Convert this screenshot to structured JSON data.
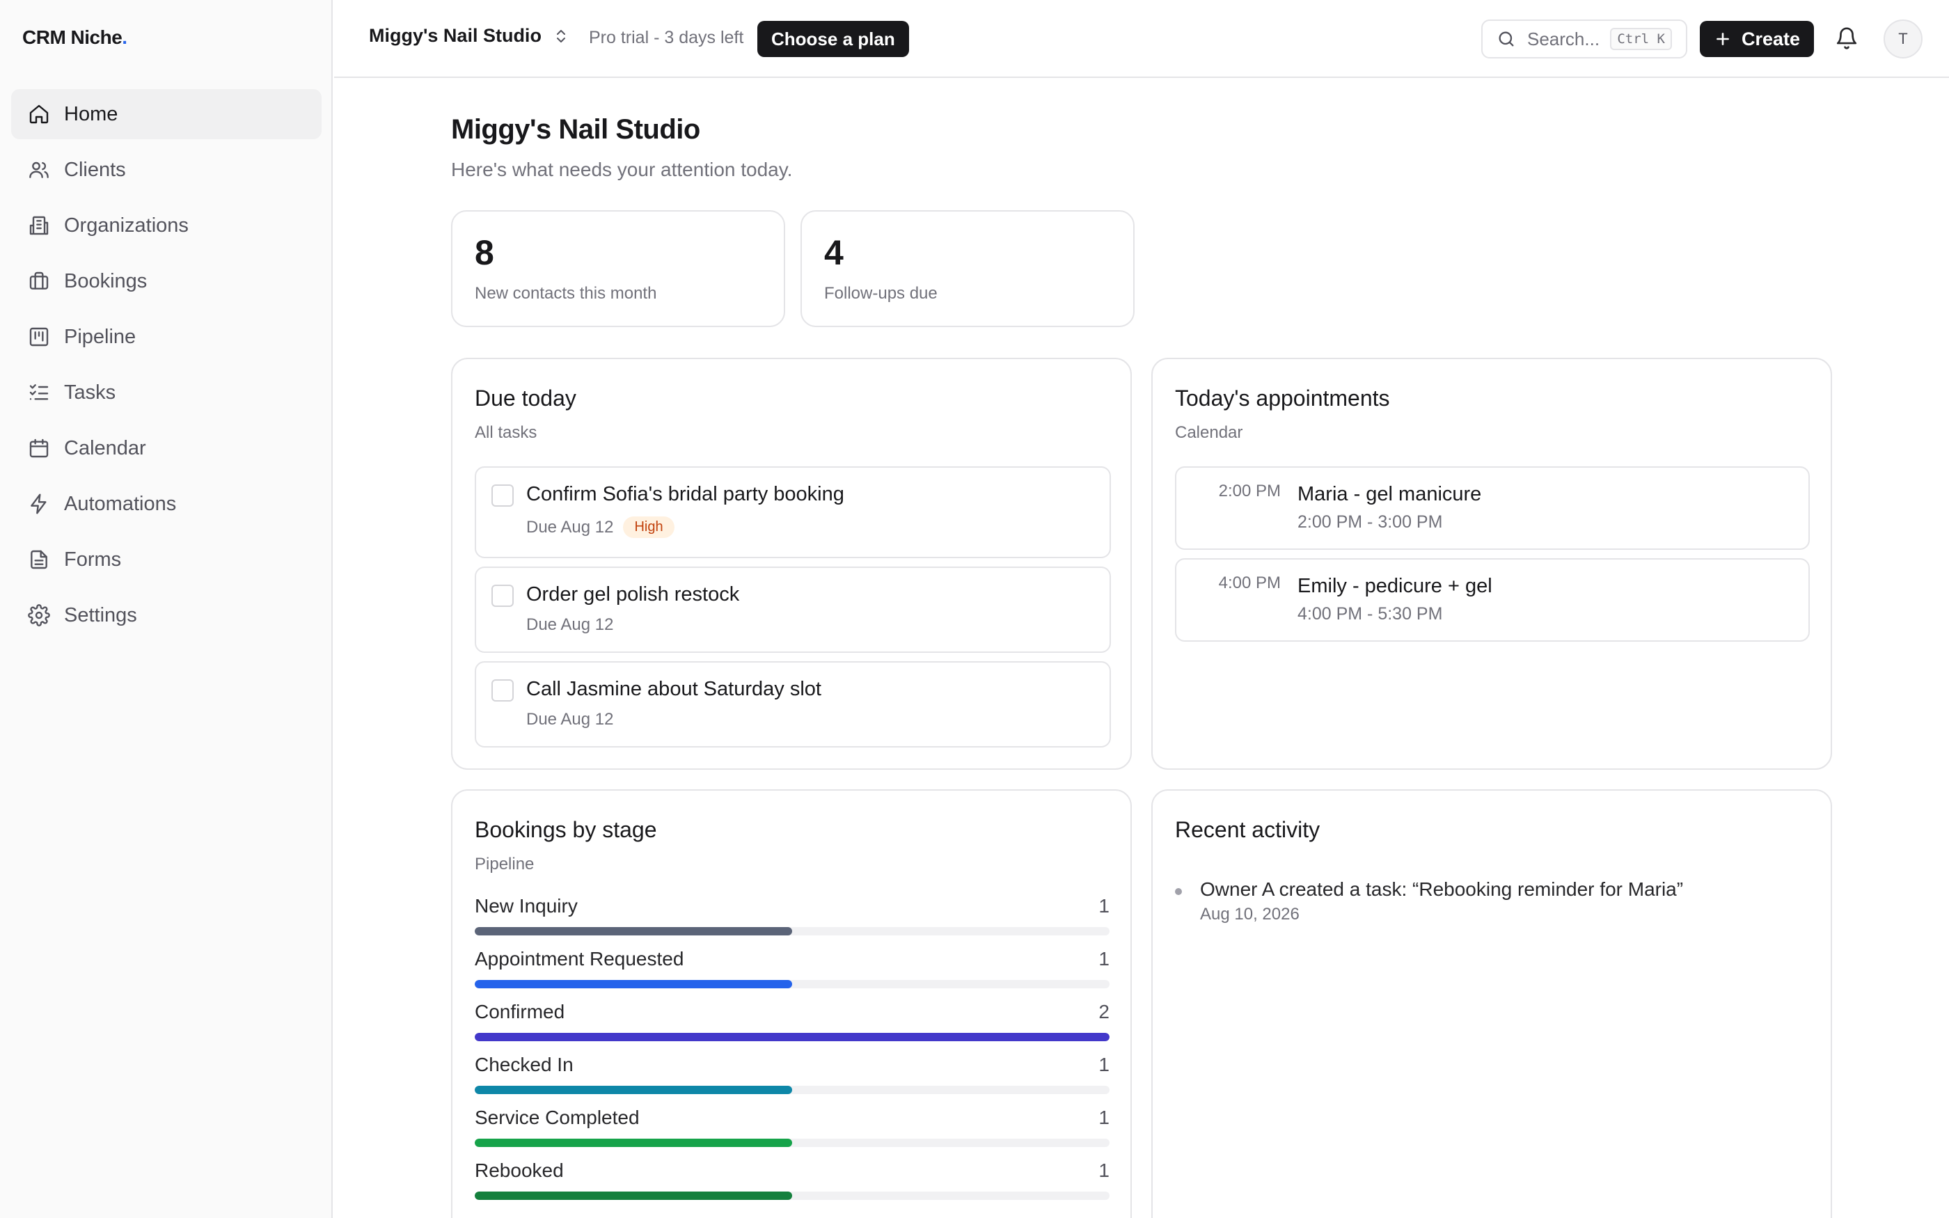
{
  "app": {
    "logo_text": "CRM Niche",
    "logo_dot": "."
  },
  "sidebar": {
    "items": [
      {
        "label": "Home",
        "icon": "home-icon",
        "active": true
      },
      {
        "label": "Clients",
        "icon": "users-icon"
      },
      {
        "label": "Organizations",
        "icon": "building-icon"
      },
      {
        "label": "Bookings",
        "icon": "briefcase-icon"
      },
      {
        "label": "Pipeline",
        "icon": "kanban-icon"
      },
      {
        "label": "Tasks",
        "icon": "list-checks-icon"
      },
      {
        "label": "Calendar",
        "icon": "calendar-icon"
      },
      {
        "label": "Automations",
        "icon": "zap-icon"
      },
      {
        "label": "Forms",
        "icon": "file-text-icon"
      },
      {
        "label": "Settings",
        "icon": "gear-icon"
      }
    ]
  },
  "topbar": {
    "workspace": "Miggy's Nail Studio",
    "trial_text": "Pro trial - 3 days left",
    "plan_button": "Choose a plan",
    "search_placeholder": "Search...",
    "search_shortcut": "Ctrl K",
    "create_button": "Create",
    "avatar_initial": "T"
  },
  "main": {
    "title": "Miggy's Nail Studio",
    "subtitle": "Here's what needs your attention today.",
    "stats": [
      {
        "value": "8",
        "label": "New contacts this month"
      },
      {
        "value": "4",
        "label": "Follow-ups due"
      }
    ],
    "due_today": {
      "title": "Due today",
      "subtitle": "All tasks",
      "tasks": [
        {
          "title": "Confirm Sofia's bridal party booking",
          "due": "Due Aug 12",
          "badge": "High"
        },
        {
          "title": "Order gel polish restock",
          "due": "Due Aug 12"
        },
        {
          "title": "Call Jasmine about Saturday slot",
          "due": "Due Aug 12"
        }
      ]
    },
    "appointments": {
      "title": "Today's appointments",
      "subtitle": "Calendar",
      "items": [
        {
          "time": "2:00 PM",
          "title": "Maria - gel manicure",
          "range": "2:00 PM - 3:00 PM"
        },
        {
          "time": "4:00 PM",
          "title": "Emily - pedicure + gel",
          "range": "4:00 PM - 5:30 PM"
        }
      ]
    },
    "bookings_by_stage": {
      "title": "Bookings by stage",
      "subtitle": "Pipeline",
      "max": 2,
      "stages": [
        {
          "name": "New Inquiry",
          "count": "1",
          "value": 1,
          "color": "#5b6478"
        },
        {
          "name": "Appointment Requested",
          "count": "1",
          "value": 1,
          "color": "#2563eb"
        },
        {
          "name": "Confirmed",
          "count": "2",
          "value": 2,
          "color": "#4338ca"
        },
        {
          "name": "Checked In",
          "count": "1",
          "value": 1,
          "color": "#0e87a8"
        },
        {
          "name": "Service Completed",
          "count": "1",
          "value": 1,
          "color": "#16a34a"
        },
        {
          "name": "Rebooked",
          "count": "1",
          "value": 1,
          "color": "#15803d"
        }
      ]
    },
    "recent_activity": {
      "title": "Recent activity",
      "items": [
        {
          "text": "Owner A created a task: “Rebooking reminder for Maria”",
          "date": "Aug 10, 2026"
        }
      ]
    }
  }
}
